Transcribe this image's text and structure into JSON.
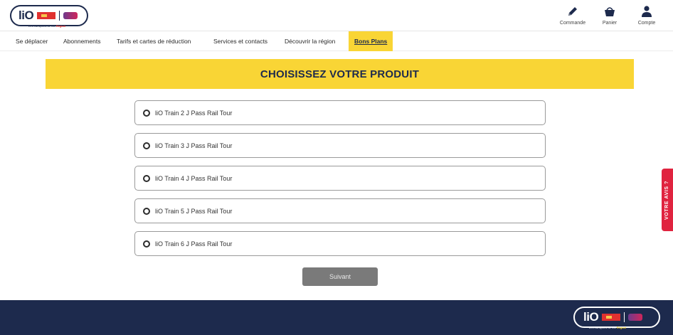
{
  "header": {
    "logo_text": "liO",
    "logo_subtitle": "Les transports de ma",
    "logo_subtitle_accent": "Région",
    "account_items": [
      {
        "label": "Commande",
        "icon": "pencil-icon"
      },
      {
        "label": "Panier",
        "icon": "basket-icon"
      },
      {
        "label": "Compte",
        "icon": "user-icon"
      }
    ]
  },
  "nav": {
    "items": [
      {
        "label": "Se déplacer"
      },
      {
        "label": "Abonnements"
      },
      {
        "label": "Tarifs et cartes de réduction"
      },
      {
        "label": "Services et contacts"
      },
      {
        "label": "Découvrir la région"
      },
      {
        "label": "Bons Plans",
        "active": true
      }
    ]
  },
  "main": {
    "title": "CHOISISSEZ VOTRE PRODUIT",
    "options": [
      {
        "label": "liO Train 2 J Pass Rail Tour",
        "selected": false
      },
      {
        "label": "liO Train 3 J Pass Rail Tour",
        "selected": false
      },
      {
        "label": "liO Train 4 J Pass Rail Tour",
        "selected": false
      },
      {
        "label": "liO Train 5 J Pass Rail Tour",
        "selected": false
      },
      {
        "label": "liO Train 6 J Pass Rail Tour",
        "selected": false
      }
    ],
    "next_label": "Suivant"
  },
  "feedback": {
    "label": "VOTRE AVIS ?"
  },
  "footer": {
    "logo_text": "liO",
    "logo_subtitle": "Les transports de ma",
    "logo_subtitle_accent": "Région"
  },
  "colors": {
    "accent": "#f9d535",
    "navy": "#1d2a4d",
    "feedback_red": "#e0233f",
    "button_gray": "#7a7a7a"
  }
}
